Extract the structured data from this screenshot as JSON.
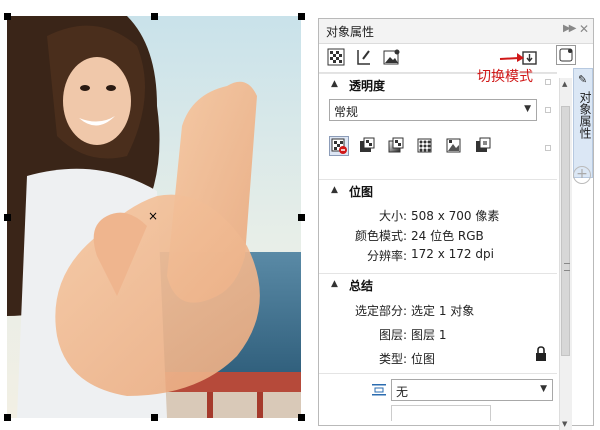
{
  "panel": {
    "title": "对象属性",
    "tab_label": "对象属性",
    "annotation": "切换模式"
  },
  "transparency": {
    "section_title": "透明度",
    "blend_mode": "常规"
  },
  "bitmap": {
    "section_title": "位图",
    "rows": [
      {
        "key": "大小:",
        "value": "508 x 700 像素"
      },
      {
        "key": "颜色模式:",
        "value": "24 位色 RGB"
      },
      {
        "key": "分辨率:",
        "value": "172 x 172 dpi"
      }
    ]
  },
  "summary": {
    "section_title": "总结",
    "rows": [
      {
        "key": "选定部分:",
        "value": "选定 1 对象"
      },
      {
        "key": "图层:",
        "value": "图层 1"
      },
      {
        "key": "类型:",
        "value": "位图"
      }
    ]
  },
  "wrap": {
    "value": "无"
  },
  "icons": {
    "toolbar": [
      "checker-fill-icon",
      "outline-pen-icon",
      "image-icon",
      "switch-mode-icon"
    ],
    "transparency_types": [
      "no-transparency-icon",
      "uniform-transparency-icon",
      "gradient-transparency-icon",
      "vector-pattern-transparency-icon",
      "bitmap-pattern-transparency-icon",
      "texture-transparency-icon"
    ]
  },
  "colors": {
    "accent": "#d01818",
    "panel_border": "#b9b9b9",
    "tab_bg": "#dbe7f5"
  }
}
